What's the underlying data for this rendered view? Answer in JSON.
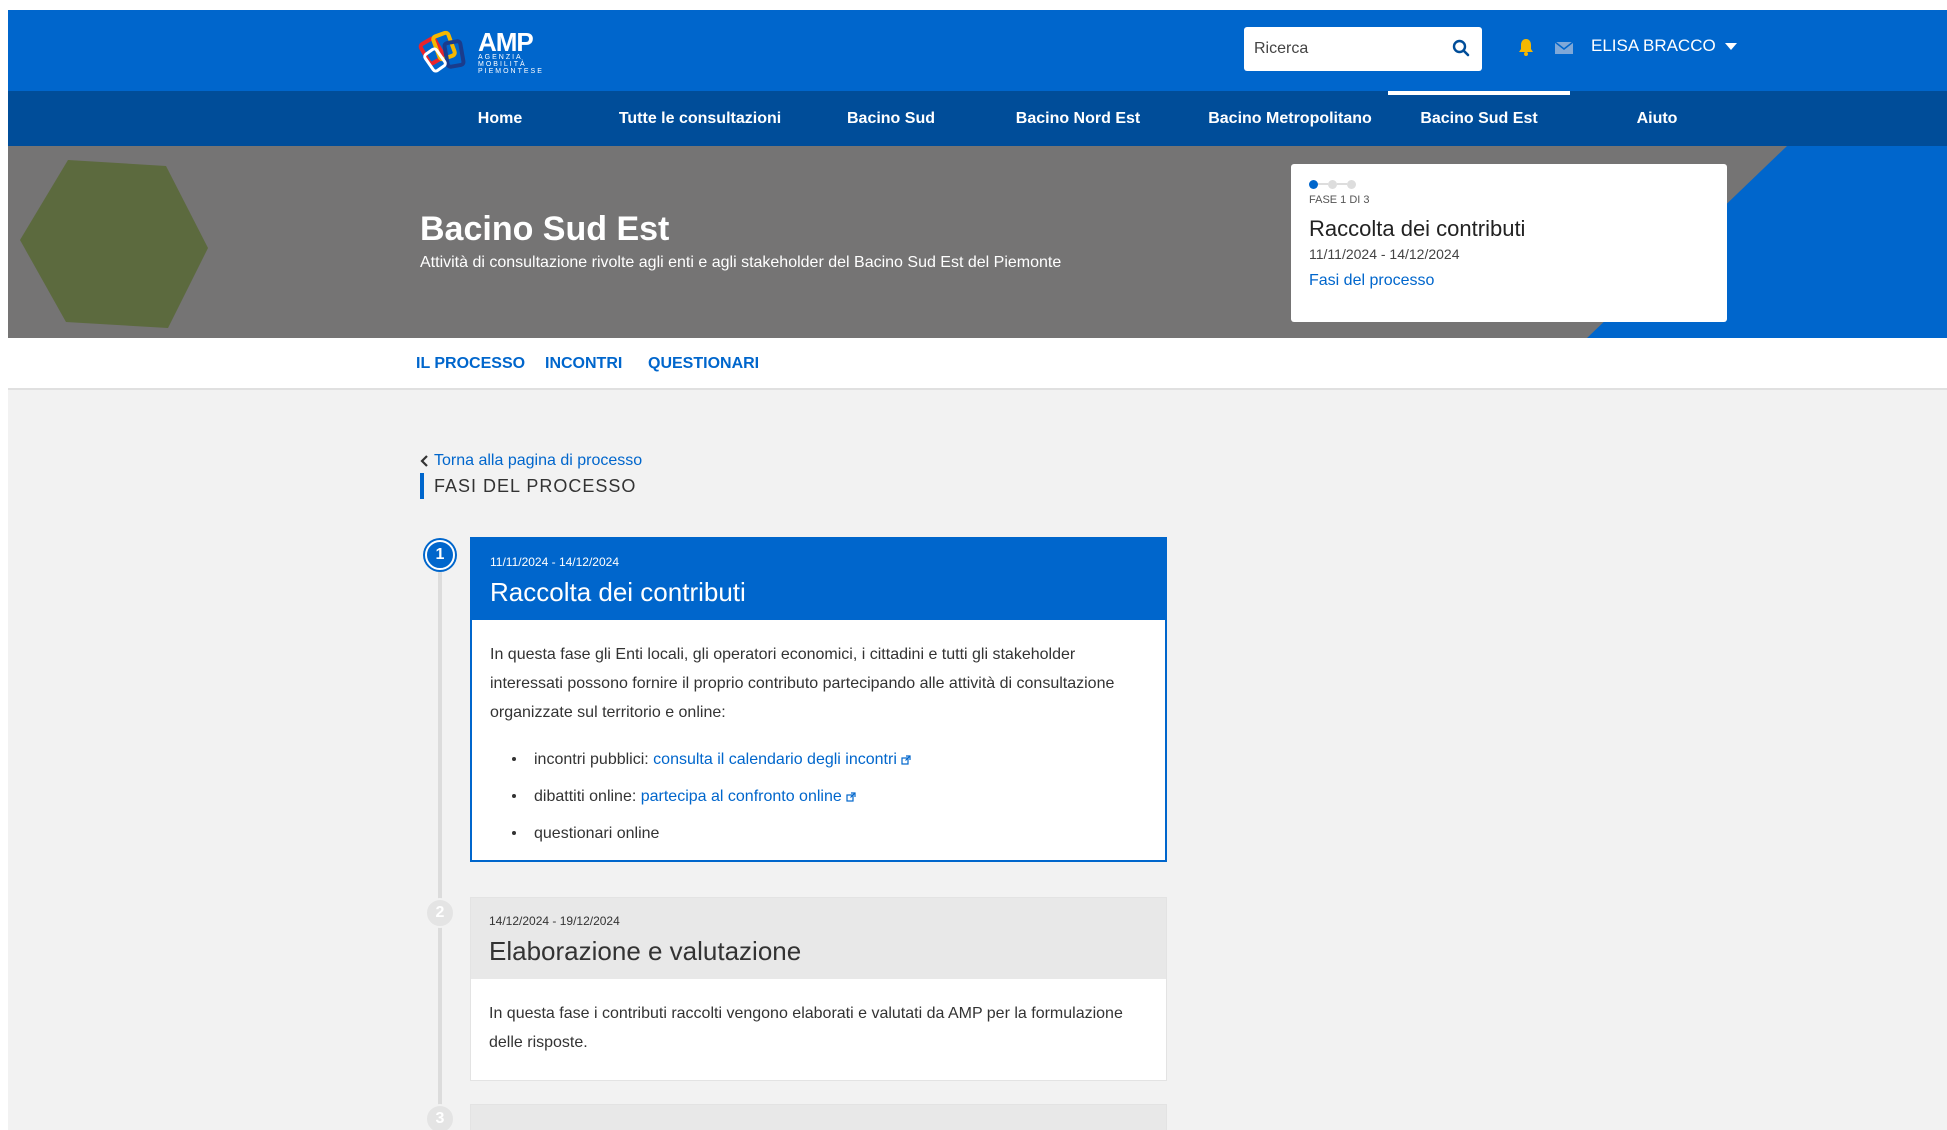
{
  "header": {
    "logo_text": "AMP",
    "logo_sub": [
      "AGENZIA",
      "MOBILITÀ",
      "PIEMONTESE"
    ],
    "search_placeholder": "Ricerca",
    "user_name": "ELISA BRACCO"
  },
  "nav": {
    "items": [
      {
        "label": "Home"
      },
      {
        "label": "Tutte le consultazioni"
      },
      {
        "label": "Bacino Sud"
      },
      {
        "label": "Bacino Nord Est"
      },
      {
        "label": "Bacino Metropolitano"
      },
      {
        "label": "Bacino Sud Est",
        "active": true
      },
      {
        "label": "Aiuto"
      }
    ]
  },
  "hero": {
    "title": "Bacino Sud Est",
    "subtitle": "Attività di consultazione rivolte agli enti e agli stakeholder del Bacino Sud Est del Piemonte",
    "phase_card": {
      "step": "FASE 1 DI 3",
      "title": "Raccolta dei contributi",
      "dates": "11/11/2024 - 14/12/2024",
      "link": "Fasi del processo"
    }
  },
  "subnav": {
    "items": [
      {
        "label": "IL PROCESSO"
      },
      {
        "label": "INCONTRI"
      },
      {
        "label": "QUESTIONARI"
      }
    ]
  },
  "content": {
    "back_link": "Torna alla pagina di processo",
    "section_title": "FASI DEL PROCESSO",
    "phases": [
      {
        "number": "1",
        "dates": "11/11/2024 - 14/12/2024",
        "title": "Raccolta dei contributi",
        "description": "In questa fase gli Enti locali, gli operatori economici, i cittadini e tutti gli stakeholder interessati possono fornire il proprio contributo partecipando alle attività di consultazione organizzate sul territorio e online:",
        "items": [
          {
            "text": "incontri pubblici: ",
            "link": "consulta il calendario degli incontri"
          },
          {
            "text": "dibattiti online: ",
            "link": "partecipa al confronto online"
          },
          {
            "text": "questionari online"
          }
        ]
      },
      {
        "number": "2",
        "dates": "14/12/2024 - 19/12/2024",
        "title": "Elaborazione e valutazione",
        "description": "In questa fase i contributi raccolti vengono elaborati e valutati da AMP per la formulazione delle risposte."
      },
      {
        "number": "3"
      }
    ]
  },
  "colors": {
    "primary": "#0066cc",
    "nav_dark": "#004d99",
    "hero_gray": "#757474",
    "hexagon": "#5c6a3e",
    "bell": "#f5b800"
  }
}
